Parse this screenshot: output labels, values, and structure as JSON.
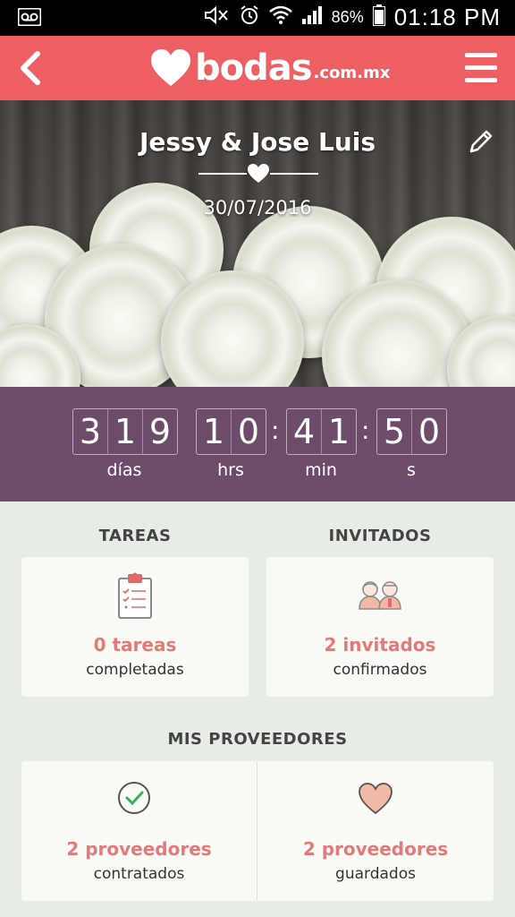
{
  "status_bar": {
    "battery_percent": "86%",
    "time": "01:18 PM",
    "icons": [
      "voicemail-icon",
      "mute-icon",
      "alarm-icon",
      "wifi-icon",
      "signal-icon",
      "battery-icon"
    ]
  },
  "app_bar": {
    "brand": "bodas",
    "brand_tld": ".com.mx",
    "back_icon": "chevron-left-icon",
    "menu_icon": "hamburger-menu-icon"
  },
  "hero": {
    "couple": "Jessy & Jose Luis",
    "date": "30/07/2016",
    "edit_icon": "pencil-icon"
  },
  "countdown": {
    "days": [
      "3",
      "1",
      "9"
    ],
    "hours": [
      "1",
      "0"
    ],
    "minutes": [
      "4",
      "1"
    ],
    "seconds": [
      "5",
      "0"
    ],
    "labels": {
      "days": "días",
      "hours": "hrs",
      "minutes": "min",
      "seconds": "s"
    }
  },
  "tasks": {
    "title": "TAREAS",
    "count": "0 tareas",
    "status": "completadas",
    "icon": "clipboard-checklist-icon"
  },
  "guests": {
    "title": "INVITADOS",
    "count": "2 invitados",
    "status": "confirmados",
    "icon": "couple-icon"
  },
  "vendors": {
    "title": "MIS PROVEEDORES",
    "hired": {
      "count": "2 proveedores",
      "status": "contratados",
      "icon": "check-circle-icon"
    },
    "saved": {
      "count": "2 proveedores",
      "status": "guardados",
      "icon": "heart-icon"
    }
  },
  "colors": {
    "app_bar": "#ee5f63",
    "countdown_bg": "#6d4b6a",
    "accent_text": "#e17a78",
    "page_bg": "#e8ece6",
    "card_bg": "#f8faf6"
  }
}
